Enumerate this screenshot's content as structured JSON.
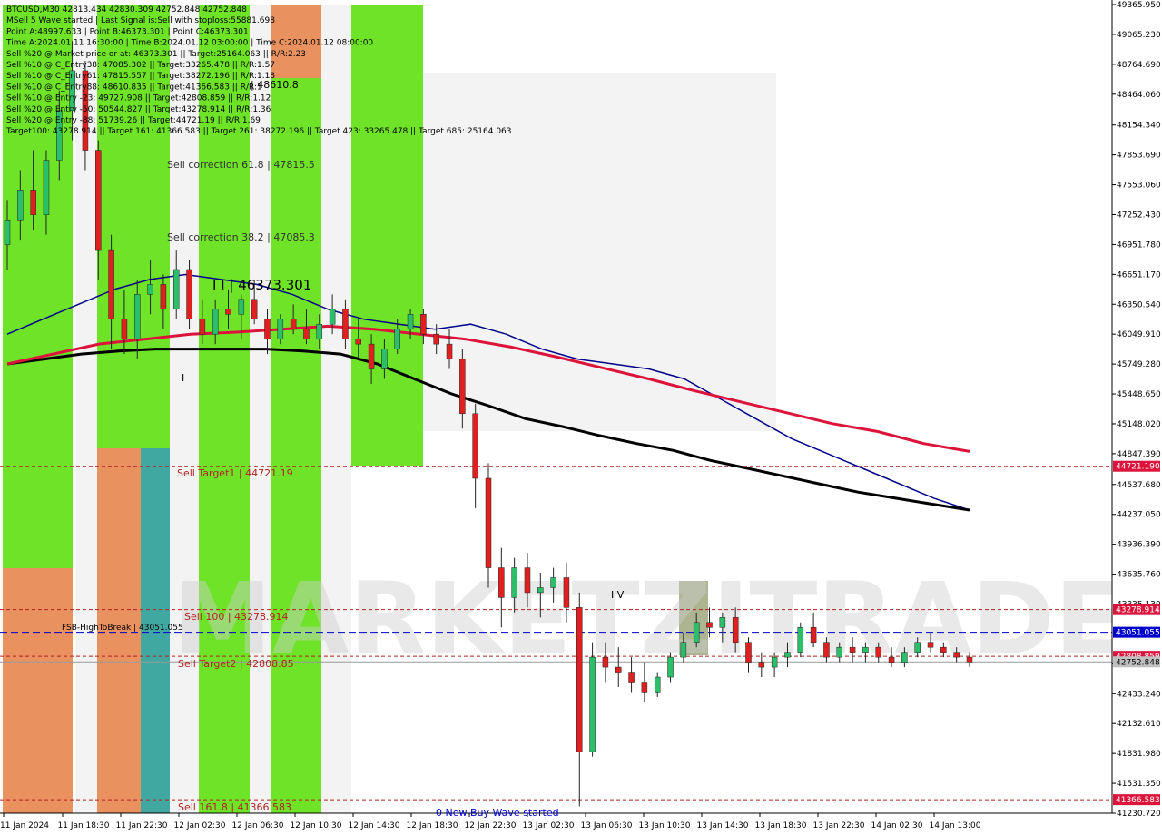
{
  "colors": {
    "background": "#ffffff",
    "green_zone": "#66e21c",
    "orange_zone": "#e88b56",
    "teal_zone": "#36a39c",
    "gray_zone": "#dcdcdc",
    "olive_zone": "#a8b08a",
    "bull_candle": "#2bbf6a",
    "bear_candle": "#e02020",
    "ma_red": "#dc143c",
    "ma_black": "#000000",
    "ma_blue": "#00008b",
    "magenta": "#cc00cc",
    "level_red": "#b22222",
    "level_blue": "#0000cd",
    "arrow_up": "#0000ff",
    "arrow_down": "#ff0000"
  },
  "info_panel": [
    "BTCUSD,M30  42813.434 42830.309 42752.848 42752.848",
    "MSell 5 Wave started | Last Signal is:Sell with stoploss:55881.698",
    "Point A:48997.633 | Point B:46373.301 | Point C:46373.301",
    "Time A:2024.01.11 16:30:00 | Time B:2024.01.12 03:00:00 | Time C:2024.01.12 08:00:00",
    "Sell %20 @ Market price or at: 46373.301 || Target:25164.063 || R/R:2.23",
    "Sell %10 @ C_Entry38: 47085.302 || Target:33265.478 || R/R:1.57",
    "Sell %10 @ C_Entry61: 47815.557 || Target:38272.196 || R/R:1.18",
    "Sell %10 @ C_Entry88: 48610.835 || Target:41366.583 || R/R:1",
    "Sell %10 @ Entry -23: 49727.908 || Target:42808.859 || R/R:1.12",
    "Sell %20 @ Entry -50: 50544.827 || Target:43278.914 || R/R:1.36",
    "Sell %20 @ Entry -88: 51739.26 || Target:44721.19 || R/R:1.69",
    "Target100: 43278.914 || Target 161: 41366.583 || Target 261: 38272.196 || Target 423: 33265.478 || Target 685: 25164.063"
  ],
  "annotations": {
    "sell_correction_88": "| 48610.8",
    "sell_correction_61": "Sell correction 61.8 | 47815.5",
    "sell_correction_38": "Sell correction 38.2 | 47085.3",
    "wave_ii": "I I | 46373.301",
    "wave_i": "I",
    "wave_iv": "I V",
    "sell_target1": "Sell Target1 | 44721.19",
    "sell_100": "Sell 100 | 43278.914",
    "fsb": "FSB-HighToBreak | 43051.055",
    "sell_target2": "Sell Target2 | 42808.85",
    "sell_161": "Sell 161.8 | 41366.583",
    "new_wave": "0 New Buy Wave started",
    "watermark": "MARKETZITRADE"
  },
  "level_tags": {
    "sell_target1": "44721.190",
    "sell_100": "43278.914",
    "fsb": "43051.055",
    "sell_target2": "42808.859",
    "current": "42752.848",
    "sell_161": "41366.583"
  },
  "chart_data": {
    "type": "line",
    "title": "BTCUSD,M30",
    "ylim": [
      41230.72,
      49365.95
    ],
    "y_ticks": [
      "49365.950",
      "49065.230",
      "48764.690",
      "48464.060",
      "48154.340",
      "47853.690",
      "47553.060",
      "47252.430",
      "46951.780",
      "46651.170",
      "46350.540",
      "46049.910",
      "45749.280",
      "45448.650",
      "45148.020",
      "44847.390",
      "44537.680",
      "44237.050",
      "43936.390",
      "43635.760",
      "43335.130",
      "43034.500",
      "42733.870",
      "42433.240",
      "42132.610",
      "41831.980",
      "41531.350",
      "41230.720"
    ],
    "x_ticks": [
      "11 Jan 2024",
      "11 Jan 18:30",
      "11 Jan 22:30",
      "12 Jan 02:30",
      "12 Jan 06:30",
      "12 Jan 10:30",
      "12 Jan 14:30",
      "12 Jan 18:30",
      "12 Jan 22:30",
      "13 Jan 02:30",
      "13 Jan 06:30",
      "13 Jan 10:30",
      "13 Jan 14:30",
      "13 Jan 18:30",
      "13 Jan 22:30",
      "14 Jan 02:30",
      "14 Jan 13:00"
    ],
    "levels": {
      "sell_target1": 44721.19,
      "sell_100": 43278.914,
      "fsb_high_to_break": 43051.055,
      "sell_target2": 42808.859,
      "current_price": 42752.848,
      "sell_161": 41366.583
    },
    "series": [
      {
        "values": [
          46050,
          46200,
          46350,
          46500,
          46600,
          46650,
          46600,
          46550,
          46450,
          46300,
          46200,
          46150,
          46100,
          46150,
          46050,
          45900,
          45800,
          45750,
          45700,
          45600,
          45400,
          45200,
          45000,
          44850,
          44700,
          44550,
          44400,
          44280
        ],
        "x": [
          0,
          1,
          2,
          3,
          4,
          5,
          6,
          7,
          8,
          9,
          10,
          11,
          12,
          13,
          14,
          15,
          16,
          17,
          18,
          19,
          20,
          21,
          22,
          23,
          24,
          25,
          26,
          27
        ]
      },
      {
        "values": [
          45750,
          45800,
          45850,
          45880,
          45900,
          45900,
          45900,
          45900,
          45880,
          45850,
          45750,
          45600,
          45450,
          45330,
          45200,
          45120,
          45030,
          44950,
          44880,
          44780,
          44700,
          44620,
          44540,
          44460,
          44400,
          44340,
          44280
        ],
        "x": [
          0,
          1,
          2,
          3,
          4,
          5,
          6,
          7,
          8,
          9,
          10,
          11,
          12,
          13,
          14,
          15,
          16,
          17,
          18,
          19,
          20,
          21,
          22,
          23,
          24,
          25,
          26
        ]
      },
      {
        "values": [
          45750,
          45850,
          45950,
          46000,
          46050,
          46070,
          46100,
          46130,
          46100,
          46050,
          46000,
          45920,
          45820,
          45710,
          45600,
          45480,
          45370,
          45260,
          45150,
          45070,
          44950,
          44870
        ],
        "x": [
          0,
          1,
          2,
          3,
          4,
          5,
          6,
          7,
          8,
          9,
          10,
          11,
          12,
          13,
          14,
          15,
          16,
          17,
          18,
          19,
          20,
          21
        ]
      }
    ],
    "candles": [
      [
        46950,
        47400,
        46700,
        47200
      ],
      [
        47200,
        47700,
        47000,
        47500
      ],
      [
        47500,
        47900,
        47100,
        47250
      ],
      [
        47250,
        47900,
        47050,
        47800
      ],
      [
        47800,
        48500,
        47600,
        48300
      ],
      [
        48300,
        49000,
        48000,
        48700
      ],
      [
        48700,
        48800,
        47700,
        47900
      ],
      [
        47900,
        48000,
        46600,
        46900
      ],
      [
        46900,
        47050,
        45900,
        46200
      ],
      [
        46200,
        46500,
        45850,
        46000
      ],
      [
        46000,
        46600,
        45800,
        46450
      ],
      [
        46450,
        46800,
        46250,
        46550
      ],
      [
        46550,
        46650,
        46100,
        46300
      ],
      [
        46300,
        46900,
        46200,
        46700
      ],
      [
        46700,
        46800,
        46100,
        46200
      ],
      [
        46200,
        46400,
        45950,
        46050
      ],
      [
        46050,
        46400,
        45950,
        46300
      ],
      [
        46300,
        46500,
        46100,
        46250
      ],
      [
        46250,
        46450,
        46000,
        46400
      ],
      [
        46400,
        46600,
        46150,
        46200
      ],
      [
        46200,
        46300,
        45850,
        46000
      ],
      [
        46000,
        46250,
        45950,
        46200
      ],
      [
        46200,
        46350,
        46050,
        46100
      ],
      [
        46100,
        46300,
        45950,
        46000
      ],
      [
        46000,
        46250,
        45900,
        46150
      ],
      [
        46150,
        46450,
        46050,
        46300
      ],
      [
        46300,
        46400,
        45900,
        46000
      ],
      [
        46000,
        46200,
        45800,
        45950
      ],
      [
        45950,
        46050,
        45550,
        45700
      ],
      [
        45700,
        46000,
        45600,
        45900
      ],
      [
        45900,
        46200,
        45850,
        46100
      ],
      [
        46100,
        46300,
        46000,
        46250
      ],
      [
        46250,
        46300,
        45950,
        46050
      ],
      [
        46050,
        46150,
        45850,
        45950
      ],
      [
        45950,
        46100,
        45700,
        45800
      ],
      [
        45800,
        45900,
        45100,
        45250
      ],
      [
        45250,
        45350,
        44300,
        44600
      ],
      [
        44600,
        44750,
        43500,
        43700
      ],
      [
        43700,
        43900,
        43100,
        43400
      ],
      [
        43400,
        43800,
        43250,
        43700
      ],
      [
        43700,
        43850,
        43300,
        43450
      ],
      [
        43450,
        43650,
        43200,
        43500
      ],
      [
        43500,
        43700,
        43350,
        43600
      ],
      [
        43600,
        43750,
        43150,
        43300
      ],
      [
        43300,
        43450,
        41300,
        41850
      ],
      [
        41850,
        42950,
        41800,
        42800
      ],
      [
        42800,
        42950,
        42550,
        42700
      ],
      [
        42700,
        42900,
        42500,
        42650
      ],
      [
        42650,
        42800,
        42450,
        42550
      ],
      [
        42550,
        42750,
        42350,
        42450
      ],
      [
        42450,
        42650,
        42400,
        42600
      ],
      [
        42600,
        42850,
        42550,
        42800
      ],
      [
        42800,
        43050,
        42750,
        42950
      ],
      [
        42950,
        43250,
        42900,
        43150
      ],
      [
        43150,
        43300,
        43000,
        43100
      ],
      [
        43100,
        43250,
        42950,
        43200
      ],
      [
        43200,
        43300,
        42850,
        42950
      ],
      [
        42950,
        43000,
        42650,
        42750
      ],
      [
        42750,
        42850,
        42600,
        42700
      ],
      [
        42700,
        42850,
        42600,
        42800
      ],
      [
        42800,
        42950,
        42700,
        42850
      ],
      [
        42850,
        43150,
        42800,
        43100
      ],
      [
        43100,
        43250,
        42900,
        42950
      ],
      [
        42950,
        43000,
        42750,
        42800
      ],
      [
        42800,
        42950,
        42750,
        42900
      ],
      [
        42900,
        43000,
        42750,
        42850
      ],
      [
        42850,
        42950,
        42750,
        42900
      ],
      [
        42900,
        42950,
        42750,
        42800
      ],
      [
        42800,
        42900,
        42700,
        42750
      ],
      [
        42750,
        42900,
        42700,
        42850
      ],
      [
        42850,
        43000,
        42800,
        42950
      ],
      [
        42950,
        43050,
        42850,
        42900
      ],
      [
        42900,
        42950,
        42800,
        42850
      ],
      [
        42850,
        42900,
        42750,
        42800
      ],
      [
        42800,
        42850,
        42700,
        42752
      ]
    ]
  }
}
